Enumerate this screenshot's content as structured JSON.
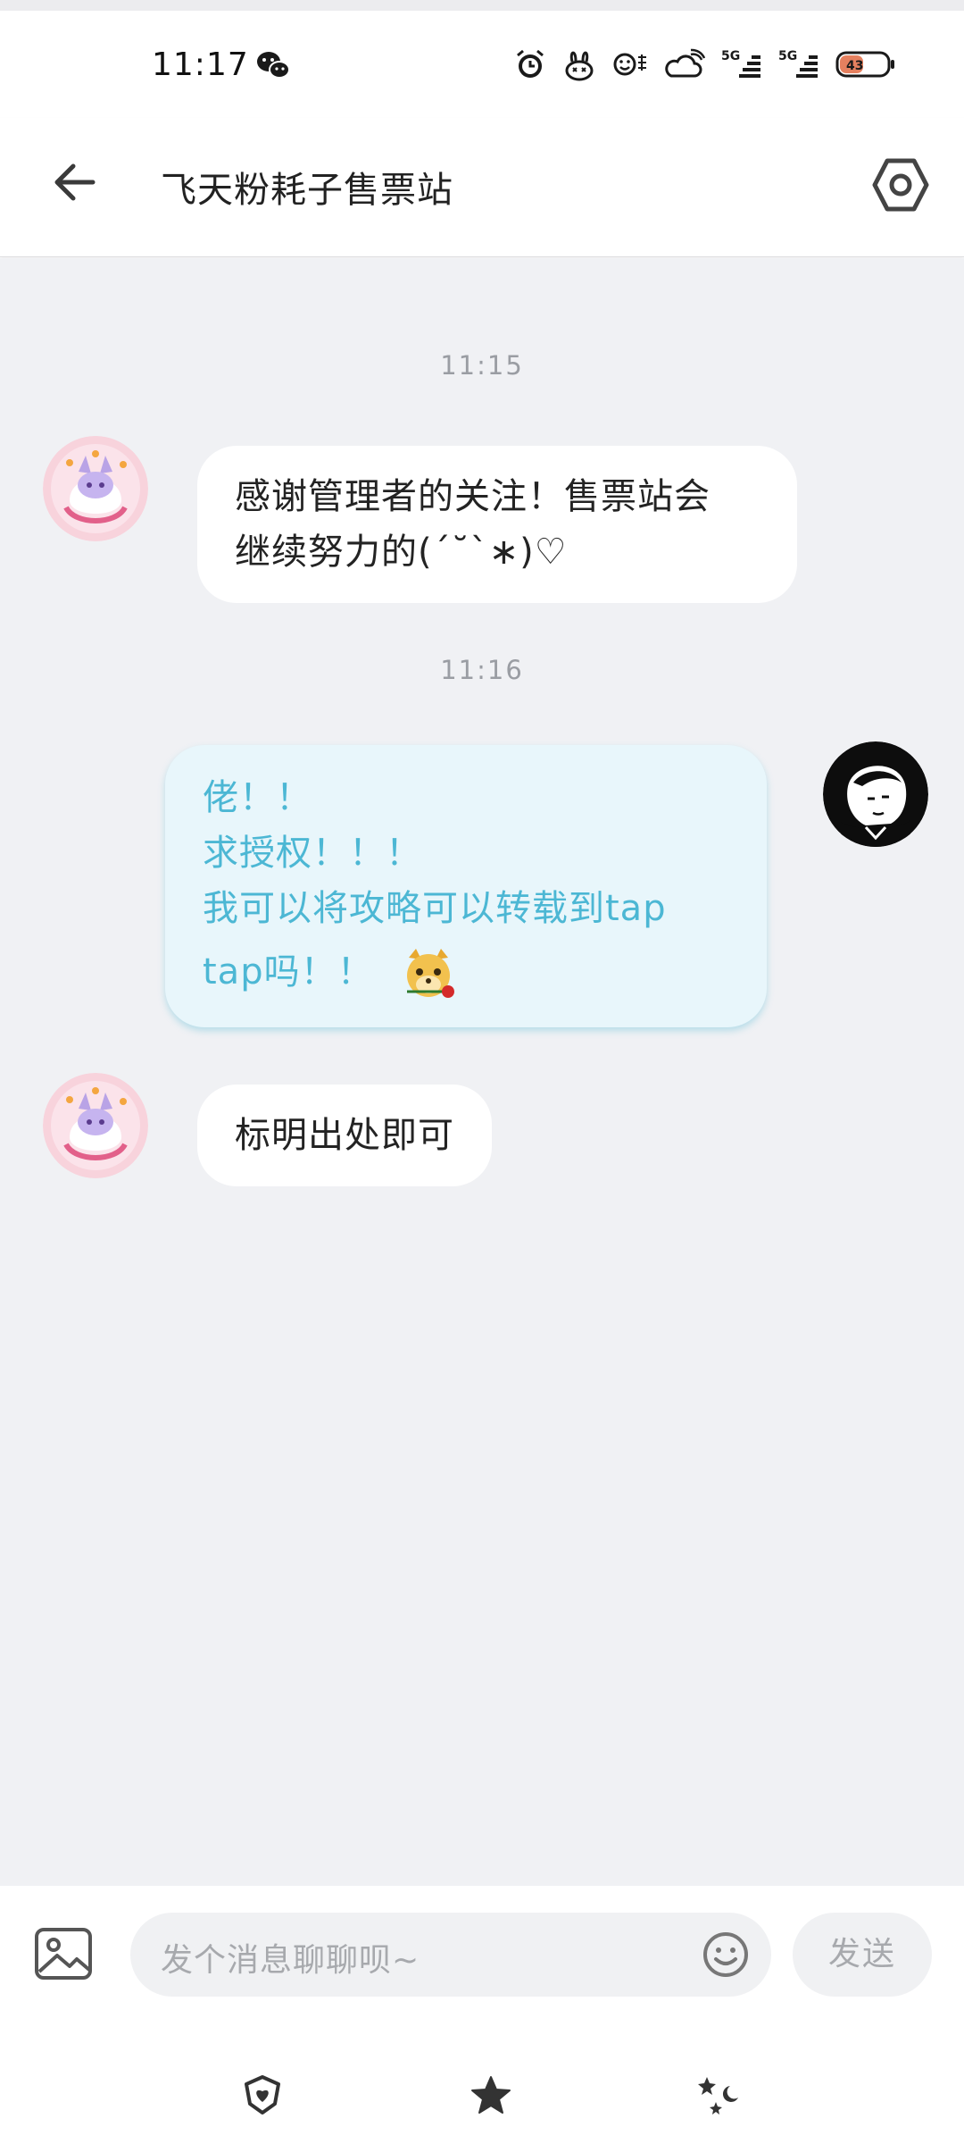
{
  "status_bar": {
    "time": "11:17",
    "icons": [
      "wechat-icon",
      "alarm-icon",
      "bunny-icon",
      "face-icon",
      "cloud-wifi-icon",
      "signal-5g-icon",
      "signal-5g-icon",
      "battery-icon"
    ],
    "network_1": "5G",
    "network_2": "5G",
    "battery_level": "43"
  },
  "header": {
    "title": "飞天粉耗子售票站",
    "back_icon": "back-arrow-icon",
    "settings_icon": "settings-icon"
  },
  "messages": [
    {
      "type": "timestamp",
      "text": "11:15"
    },
    {
      "type": "received",
      "lines": [
        "感谢管理者的关注！售票站会",
        "继续努力的(´˘`∗)♡"
      ]
    },
    {
      "type": "timestamp",
      "text": "11:16"
    },
    {
      "type": "sent",
      "lines": [
        "佬！！",
        "求授权！！！",
        "我可以将攻略可以转载到tap",
        "tap吗！！"
      ],
      "sticker": "dog-with-rose-emoji"
    },
    {
      "type": "received",
      "lines": [
        "标明出处即可"
      ]
    }
  ],
  "input": {
    "placeholder": "发个消息聊聊呗~",
    "send_label": "发送",
    "image_icon": "image-icon",
    "emoji_icon": "emoji-icon"
  },
  "bottom_nav": [
    "shield-heart-icon",
    "star-icon",
    "stars-moon-icon"
  ],
  "colors": {
    "accent": "#4cb7d4",
    "sent_bubble": "#e8f6fb",
    "chat_bg": "#f0f1f4"
  }
}
